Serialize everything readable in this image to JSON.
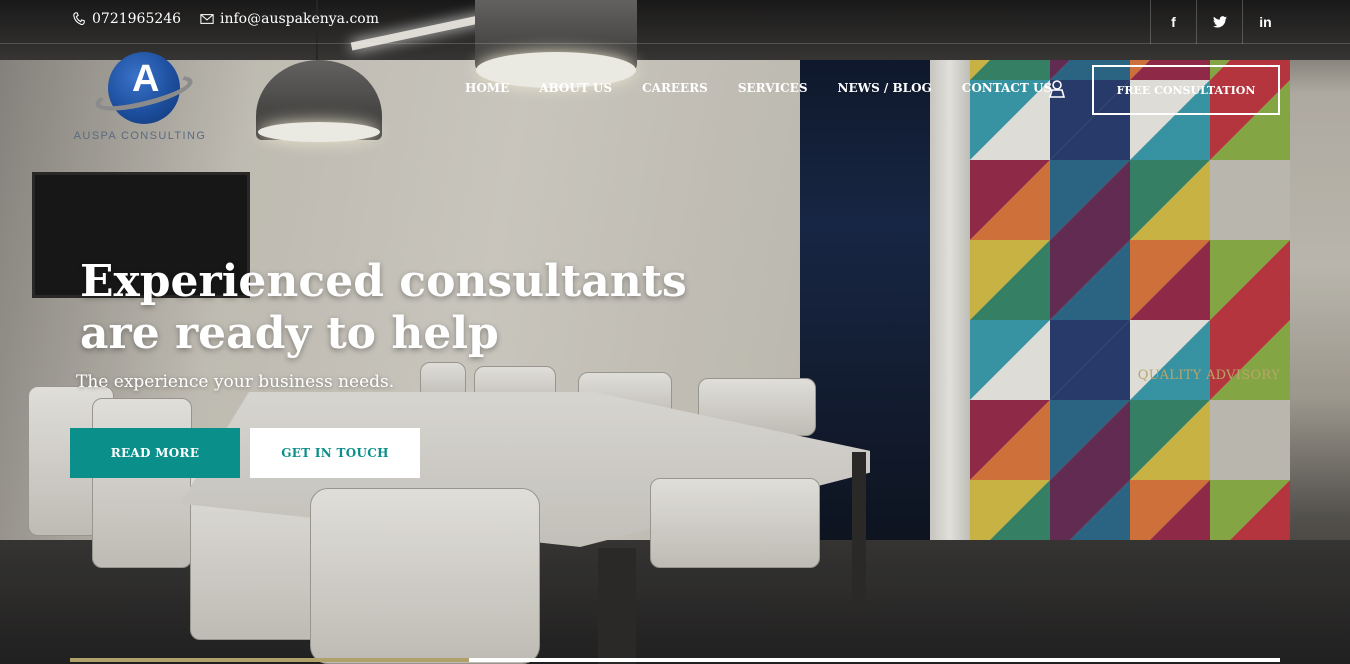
{
  "topbar": {
    "phone": "0721965246",
    "email": "info@auspakenya.com",
    "social": [
      {
        "icon": "facebook-icon",
        "label": "f"
      },
      {
        "icon": "twitter-icon",
        "label": "t"
      },
      {
        "icon": "linkedin-icon",
        "label": "in"
      }
    ]
  },
  "logo": {
    "letter": "A",
    "text": "AUSPA CONSULTING"
  },
  "nav": {
    "items": [
      "HOME",
      "ABOUT US",
      "CAREERS",
      "SERVICES",
      "NEWS / BLOG",
      "CONTACT US"
    ],
    "cta": "FREE CONSULTATION"
  },
  "hero": {
    "title_line1": "Experienced consultants",
    "title_line2": "are ready to help",
    "subtitle": "The experience your business needs.",
    "btn_primary": "READ MORE",
    "btn_secondary": "GET IN TOUCH",
    "tag": "QUALITY ADVISORY"
  },
  "slider": {
    "progress": 0.33
  },
  "colors": {
    "accent": "#0b8f8a",
    "gold": "#b9a56a",
    "white": "#ffffff"
  }
}
